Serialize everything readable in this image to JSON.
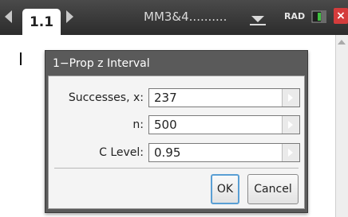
{
  "topbar": {
    "tab_label": "1.1",
    "document_title": "MM3&4..........",
    "angle_mode": "RAD",
    "close_symbol": "×"
  },
  "dialog": {
    "title": "1−Prop z Interval",
    "fields": [
      {
        "label": "Successes, x:",
        "value": "237"
      },
      {
        "label": "n:",
        "value": "500"
      },
      {
        "label": "C Level:",
        "value": "0.95"
      }
    ],
    "ok_label": "OK",
    "cancel_label": "Cancel"
  },
  "colors": {
    "topbar": "#2c2c2c",
    "dialog_frame": "#5a5a5a",
    "focus": "#5a9fd4",
    "close": "#d43c3c"
  }
}
